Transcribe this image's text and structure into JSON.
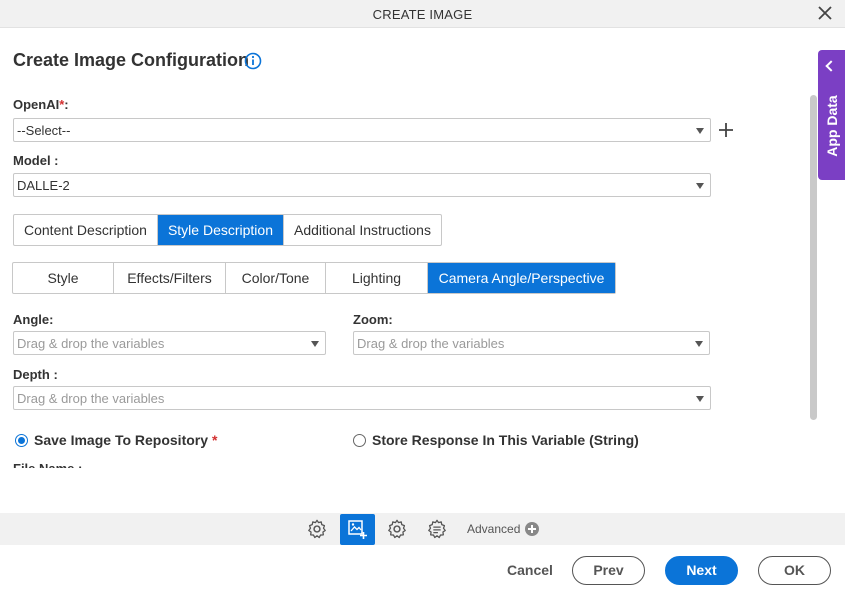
{
  "window": {
    "title": "CREATE IMAGE"
  },
  "heading": "Create Image Configuration",
  "openai": {
    "label": "OpenAI",
    "required_mark": "*",
    "colon": ":",
    "value": "--Select--"
  },
  "model": {
    "label": "Model :",
    "value": "DALLE-2"
  },
  "prompt_tabs": [
    {
      "label": "Content Description",
      "active": false
    },
    {
      "label": "Style Description",
      "active": true
    },
    {
      "label": "Additional Instructions",
      "active": false
    }
  ],
  "style_tabs": [
    {
      "label": "Style",
      "active": false
    },
    {
      "label": "Effects/Filters",
      "active": false
    },
    {
      "label": "Color/Tone",
      "active": false
    },
    {
      "label": "Lighting",
      "active": false
    },
    {
      "label": "Camera Angle/Perspective",
      "active": true
    }
  ],
  "angle": {
    "label": "Angle:",
    "placeholder": "Drag & drop the variables"
  },
  "zoom": {
    "label": "Zoom:",
    "placeholder": "Drag & drop the variables"
  },
  "depth": {
    "label": "Depth :",
    "placeholder": "Drag & drop the variables"
  },
  "output": {
    "save_repo": {
      "label": "Save Image To Repository",
      "required_mark": "*",
      "checked": true
    },
    "store_var": {
      "label": "Store Response In This Variable (String)",
      "checked": false
    }
  },
  "partial_label": "File Name :",
  "side_panel": {
    "label": "App Data"
  },
  "toolbar": {
    "advanced_label": "Advanced"
  },
  "footer": {
    "cancel": "Cancel",
    "prev": "Prev",
    "next": "Next",
    "ok": "OK"
  },
  "colors": {
    "primary": "#0b74d8",
    "app_data": "#7b3fc4",
    "required": "#d32f2f"
  }
}
